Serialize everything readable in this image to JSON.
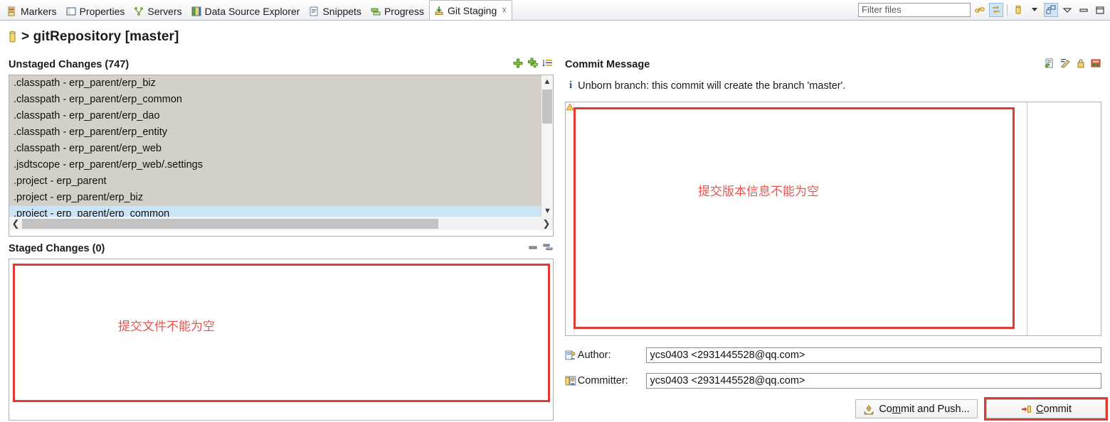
{
  "tabs": [
    {
      "label": "Markers",
      "icon": "markers-icon",
      "active": false
    },
    {
      "label": "Properties",
      "icon": "properties-icon",
      "active": false
    },
    {
      "label": "Servers",
      "icon": "servers-icon",
      "active": false
    },
    {
      "label": "Data Source Explorer",
      "icon": "data-source-explorer-icon",
      "active": false
    },
    {
      "label": "Snippets",
      "icon": "snippets-icon",
      "active": false
    },
    {
      "label": "Progress",
      "icon": "progress-icon",
      "active": false
    },
    {
      "label": "Git Staging",
      "icon": "git-staging-icon",
      "active": true
    }
  ],
  "tab_close_glyph": "☓",
  "toolbar": {
    "filter_placeholder": "Filter files",
    "filter_value": "",
    "icons": [
      {
        "name": "link-with-editor-icon"
      },
      {
        "name": "refresh-sync-icon"
      },
      {
        "name": "repository-icon"
      },
      {
        "name": "dropdown-caret-icon"
      },
      {
        "name": "presentation-toggle-icon"
      },
      {
        "name": "view-menu-icon"
      },
      {
        "name": "minimize-view-icon"
      },
      {
        "name": "maximize-view-icon"
      }
    ]
  },
  "repository": {
    "icon": "repository-icon",
    "separator": ">",
    "name": "gitRepository",
    "branch": "[master]",
    "title": "> gitRepository [master]"
  },
  "unstaged": {
    "title": "Unstaged Changes (747)",
    "count": 747,
    "icons": [
      {
        "name": "add-to-index-icon"
      },
      {
        "name": "add-all-to-index-icon"
      },
      {
        "name": "sort-presentation-icon"
      }
    ],
    "files": [
      {
        "name": ".classpath - erp_parent/erp_biz",
        "selected": false
      },
      {
        "name": ".classpath - erp_parent/erp_common",
        "selected": false
      },
      {
        "name": ".classpath - erp_parent/erp_dao",
        "selected": false
      },
      {
        "name": ".classpath - erp_parent/erp_entity",
        "selected": false
      },
      {
        "name": ".classpath - erp_parent/erp_web",
        "selected": false
      },
      {
        "name": ".jsdtscope - erp_parent/erp_web/.settings",
        "selected": false
      },
      {
        "name": ".project - erp_parent",
        "selected": false
      },
      {
        "name": ".project - erp_parent/erp_biz",
        "selected": false
      },
      {
        "name": ".project - erp_parent/erp_common",
        "selected": true
      }
    ]
  },
  "staged": {
    "title": "Staged Changes (0)",
    "count": 0,
    "icons": [
      {
        "name": "remove-from-index-icon"
      },
      {
        "name": "remove-all-from-index-icon"
      }
    ],
    "annotation": "提交文件不能为空",
    "files": []
  },
  "commit_message": {
    "title": "Commit Message",
    "icons": [
      {
        "name": "amend-commit-icon"
      },
      {
        "name": "signed-off-by-icon"
      },
      {
        "name": "sign-commit-icon"
      },
      {
        "name": "add-change-id-icon"
      }
    ],
    "info_badge": "i",
    "info_text": "Unborn branch: this commit will create the branch 'master'.",
    "value": "",
    "annotation": "提交版本信息不能为空",
    "marker_icon": "warning-marker-icon"
  },
  "author": {
    "label": "Author:",
    "icon": "author-icon",
    "value": "ycs0403 <2931445528@qq.com>"
  },
  "committer": {
    "label": "Committer:",
    "icon": "committer-icon",
    "value": "ycs0403 <2931445528@qq.com>"
  },
  "buttons": {
    "commit_and_push": {
      "label_pre": "Co",
      "label_mnemonic": "m",
      "label_post": "mit and Push...",
      "full": "Commit and Push...",
      "icon": "push-icon"
    },
    "commit": {
      "label_mnemonic": "C",
      "label_post": "ommit",
      "full": "Commit",
      "icon": "commit-icon",
      "highlighted": true
    }
  },
  "colors": {
    "annotation_red": "#e8534e",
    "highlight_ring": "#e03a35",
    "selection_blue": "#cce4f7",
    "list_bg": "#d4d0c8",
    "info_blue": "#2b5797"
  }
}
